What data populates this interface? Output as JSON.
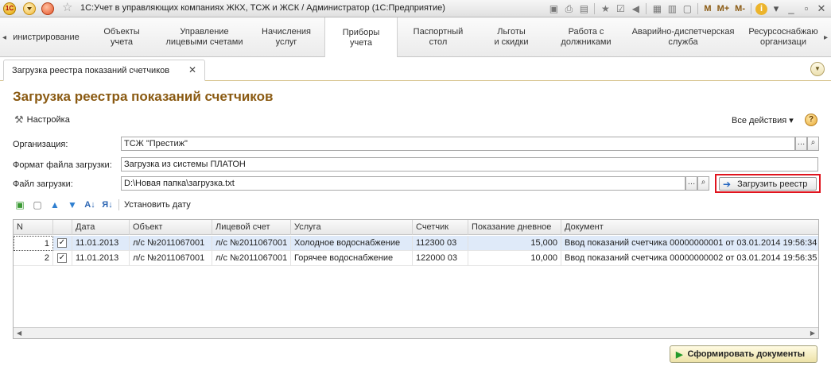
{
  "titlebar": {
    "title": "1С:Учет в управляющих компаниях ЖКХ, ТСЖ и ЖСК / Администратор  (1С:Предприятие)",
    "logo": "1С",
    "memory_buttons": [
      "M",
      "M+",
      "M-"
    ]
  },
  "sections": [
    {
      "label": "инистрирование"
    },
    {
      "label": "Объекты\nучета"
    },
    {
      "label": "Управление\nлицевыми счетами"
    },
    {
      "label": "Начисления\nуслуг"
    },
    {
      "label": "Приборы\nучета"
    },
    {
      "label": "Паспортный\nстол"
    },
    {
      "label": "Льготы\nи скидки"
    },
    {
      "label": "Работа с\nдолжниками"
    },
    {
      "label": "Аварийно-диспетчерская\nслужба"
    },
    {
      "label": "Ресурсоснабжаю\nорганизаци"
    }
  ],
  "tab": {
    "label": "Загрузка реестра показаний счетчиков"
  },
  "form": {
    "title": "Загрузка реестра показаний счетчиков",
    "settings_label": "Настройка",
    "all_actions_label": "Все действия ▾",
    "help_label": "?"
  },
  "fields": {
    "organization": {
      "label": "Организация:",
      "value": "ТСЖ \"Престиж\""
    },
    "format": {
      "label": "Формат файла загрузки:",
      "value": "Загрузка из системы ПЛАТОН"
    },
    "file": {
      "label": "Файл загрузки:",
      "value": "D:\\Новая папка\\загрузка.txt"
    }
  },
  "load_button": {
    "label": "Загрузить реестр"
  },
  "table_toolbar": {
    "set_date_label": "Установить дату"
  },
  "table": {
    "columns": [
      "N",
      "",
      "Дата",
      "Объект",
      "Лицевой счет",
      "Услуга",
      "Счетчик",
      "Показание дневное",
      "Документ"
    ],
    "rows": [
      {
        "n": "1",
        "checked": "✓",
        "date": "11.01.2013",
        "object": "л/с №2011067001",
        "account": "л/с №2011067001",
        "service": "Холодное водоснабжение",
        "meter": "112300 03",
        "reading": "15,000",
        "document": "Ввод показаний счетчика 00000000001 от 03.01.2014 19:56:34"
      },
      {
        "n": "2",
        "checked": "✓",
        "date": "11.01.2013",
        "object": "л/с №2011067001",
        "account": "л/с №2011067001",
        "service": "Горячее водоснабжение",
        "meter": "122000 03",
        "reading": "10,000",
        "document": "Ввод показаний счетчика 00000000002 от 03.01.2014 19:56:35"
      }
    ]
  },
  "form_button": {
    "label": "Сформировать документы"
  }
}
